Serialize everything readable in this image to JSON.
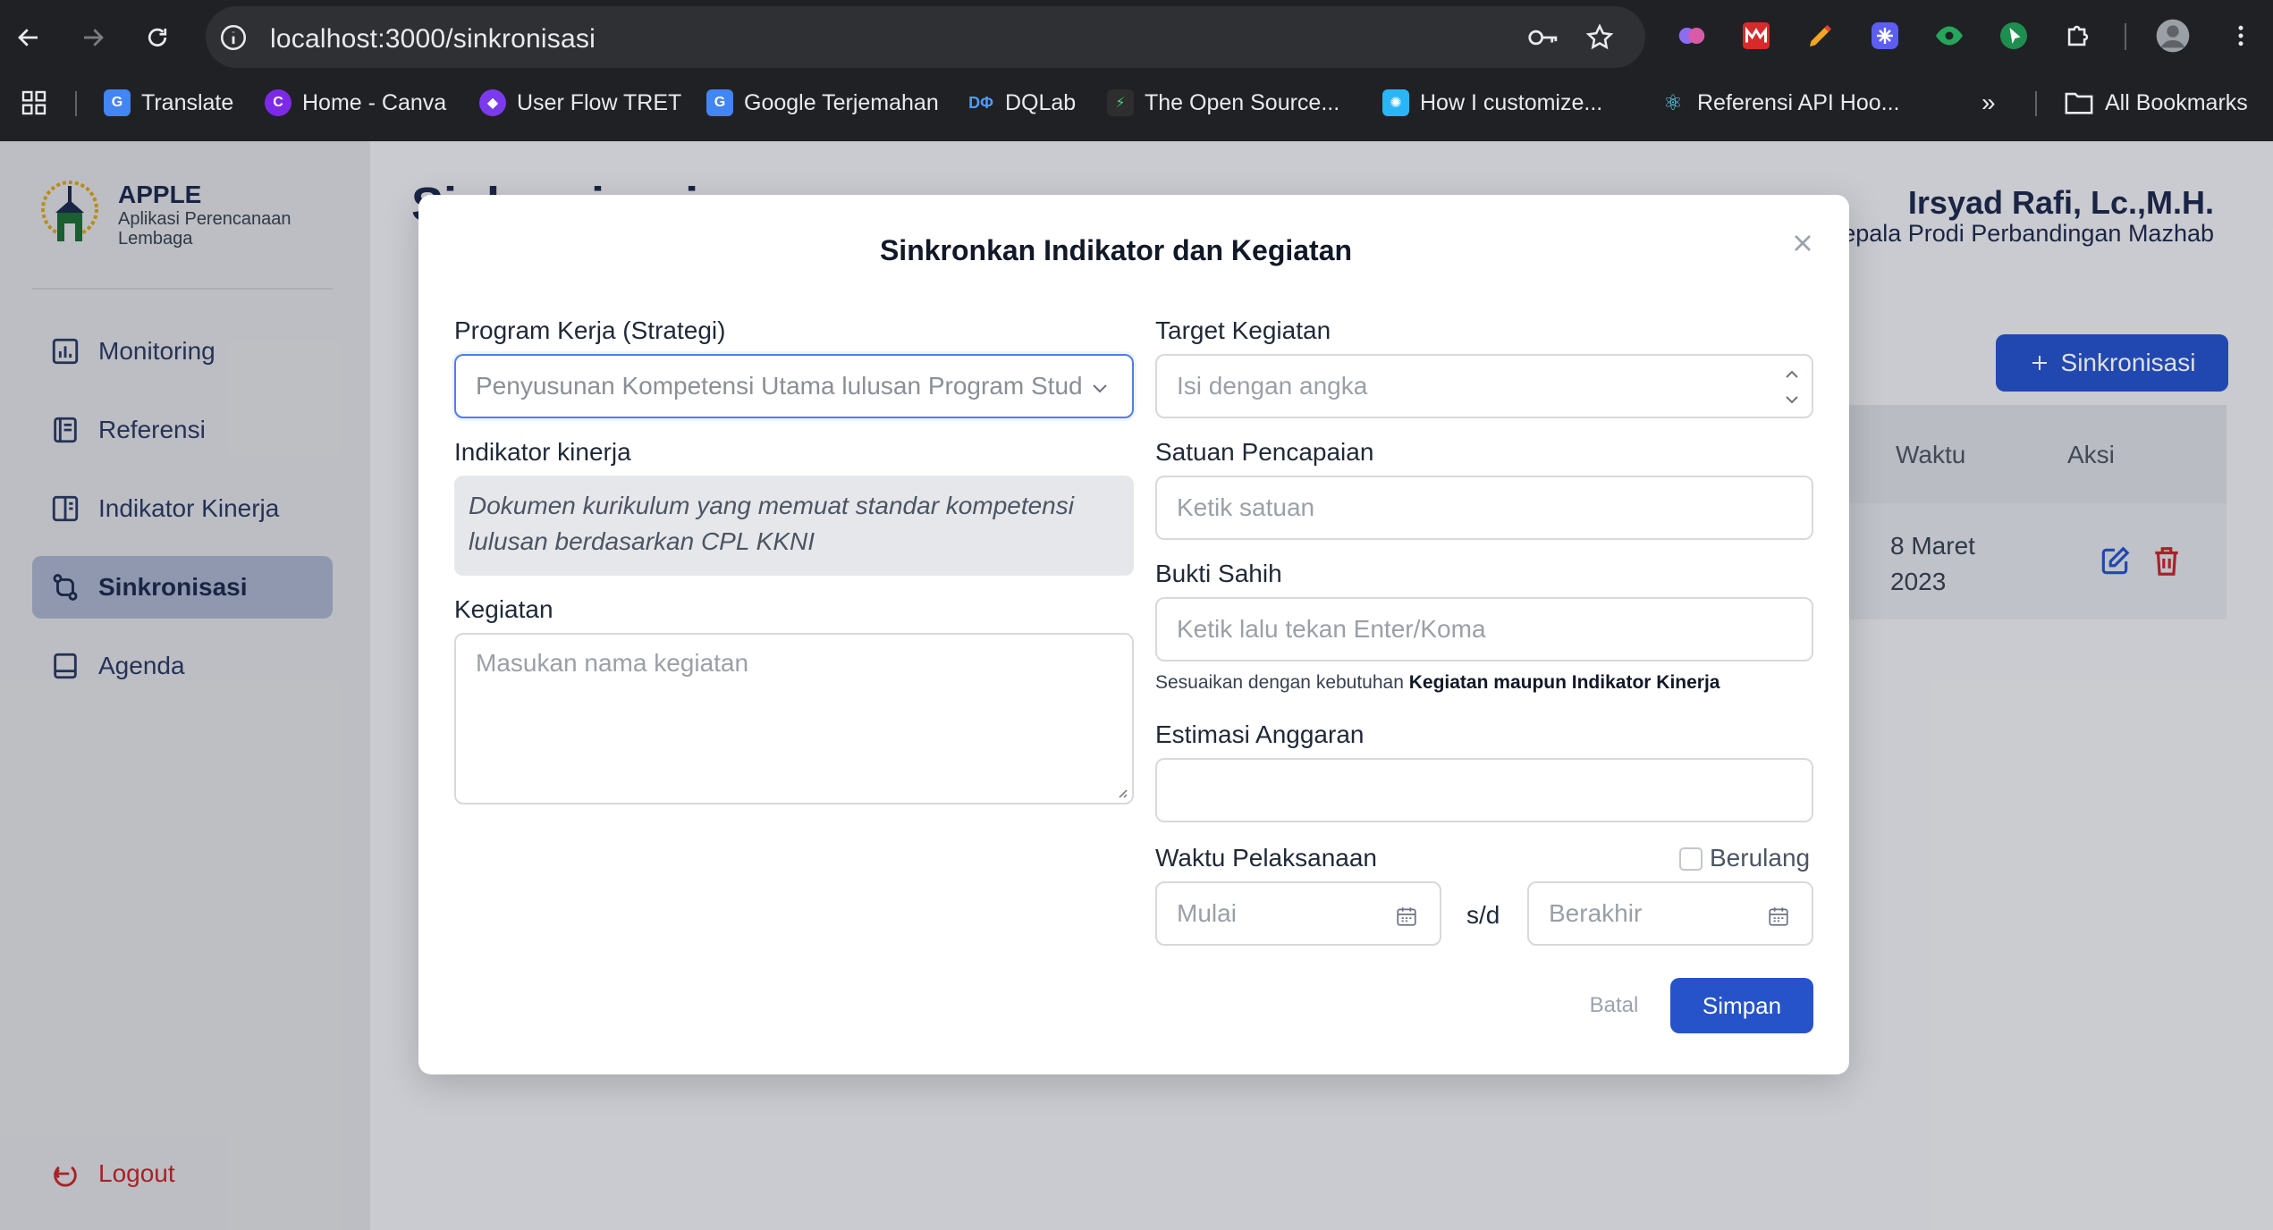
{
  "browser": {
    "url": "localhost:3000/sinkronisasi",
    "bookmarks": [
      {
        "label": "Translate",
        "icon": "google-translate-icon",
        "color": "#4285f4"
      },
      {
        "label": "Home - Canva",
        "icon": "canva-icon",
        "color": "#7d2ae8"
      },
      {
        "label": "User Flow TRET",
        "icon": "userflow-icon",
        "color": "#7c3aed"
      },
      {
        "label": "Google Terjemahan",
        "icon": "google-translate-icon",
        "color": "#4285f4"
      },
      {
        "label": "DQLab",
        "icon": "dqlab-icon",
        "color": "#1a73e8"
      },
      {
        "label": "The Open Source...",
        "icon": "open-source-icon",
        "color": "#2e2e2e"
      },
      {
        "label": "How I customize...",
        "icon": "customize-icon",
        "color": "#29b6f6"
      },
      {
        "label": "Referensi API Hoo...",
        "icon": "react-icon",
        "color": "#61dafb"
      }
    ],
    "all_bookmarks": "All Bookmarks",
    "more": "»"
  },
  "sidebar": {
    "brand_title": "APPLE",
    "brand_subtitle": "Aplikasi Perencanaan Lembaga",
    "items": [
      {
        "label": "Monitoring",
        "icon": "bar-chart-icon"
      },
      {
        "label": "Referensi",
        "icon": "book-icon"
      },
      {
        "label": "Indikator Kinerja",
        "icon": "layout-icon"
      },
      {
        "label": "Sinkronisasi",
        "icon": "sync-icon",
        "active": true
      },
      {
        "label": "Agenda",
        "icon": "agenda-icon"
      }
    ],
    "logout": "Logout"
  },
  "header": {
    "title": "Sinkronisasi",
    "user_name": "Irsyad Rafi, Lc.,M.H.",
    "user_role": "Kepala Prodi Perbandingan Mazhab",
    "add_button": "Sinkronisasi"
  },
  "table": {
    "columns": [
      "Waktu",
      "Aksi"
    ],
    "rows": [
      {
        "waktu": "8 Maret 2023"
      }
    ]
  },
  "modal": {
    "title": "Sinkronkan Indikator dan Kegiatan",
    "program_kerja_label": "Program Kerja (Strategi)",
    "program_kerja_value": "Penyusunan Kompetensi Utama lulusan Program Studi",
    "indikator_label": "Indikator kinerja",
    "indikator_value": "Dokumen kurikulum yang memuat standar kompetensi lulusan berdasarkan CPL KKNI",
    "kegiatan_label": "Kegiatan",
    "kegiatan_placeholder": "Masukan nama kegiatan",
    "target_label": "Target Kegiatan",
    "target_placeholder": "Isi dengan angka",
    "satuan_label": "Satuan Pencapaian",
    "satuan_placeholder": "Ketik satuan",
    "bukti_label": "Bukti Sahih",
    "bukti_placeholder": "Ketik lalu tekan Enter/Koma",
    "bukti_hint": "Sesuaikan dengan kebutuhan",
    "bukti_hint_bold": "Kegiatan maupun Indikator Kinerja",
    "anggaran_label": "Estimasi Anggaran",
    "waktu_label": "Waktu Pelaksanaan",
    "berulang_label": "Berulang",
    "mulai_placeholder": "Mulai",
    "sd_label": "s/d",
    "berakhir_placeholder": "Berakhir",
    "batal": "Batal",
    "simpan": "Simpan"
  },
  "colors": {
    "primary": "#2653c9",
    "danger": "#c0262d",
    "navy": "#1e2a4f"
  }
}
